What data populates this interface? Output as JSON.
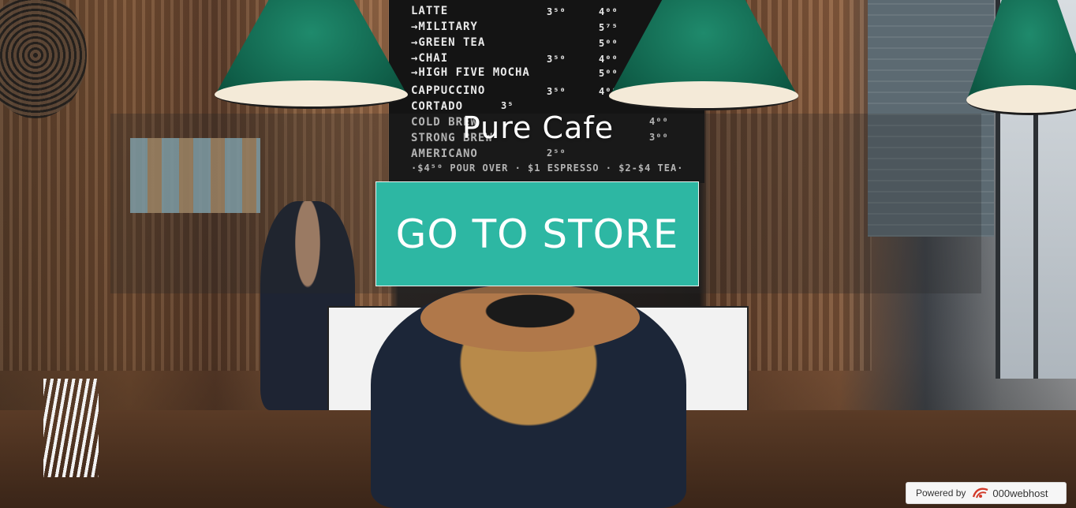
{
  "site": {
    "title": "Pure Cafe",
    "cta_label": "GO TO STORE"
  },
  "menu_board": {
    "rows": [
      {
        "item": "LATTE",
        "p1": "3⁵⁰",
        "p2": "4⁰⁰"
      },
      {
        "item": "→MILITARY",
        "p1": "",
        "p2": "5⁷⁵"
      },
      {
        "item": "→GREEN TEA",
        "p1": "",
        "p2": "5⁰⁰"
      },
      {
        "item": "→CHAI",
        "p1": "3⁵⁰",
        "p2": "4⁰⁰"
      },
      {
        "item": "→HIGH FIVE MOCHA",
        "p1": "",
        "p2": "5⁰⁰"
      },
      {
        "item": "CAPPUCCINO",
        "p1": "3⁵⁰",
        "p2": "4⁰⁰"
      },
      {
        "item": "CORTADO",
        "p1": "3⁵",
        "p2": ""
      },
      {
        "item": "COLD BREW",
        "p1": "",
        "p2": "4⁰⁰"
      },
      {
        "item": "STRONG BREW",
        "p1": "",
        "p2": "3⁰⁰"
      },
      {
        "item": "AMERICANO",
        "p1": "2⁵⁰",
        "p2": ""
      }
    ],
    "footer": "·$4⁵⁰ POUR OVER · $1 ESPRESSO · $2-$4 TEA·"
  },
  "host_badge": {
    "powered_label": "Powered by",
    "brand": "000webhost"
  },
  "colors": {
    "cta_background": "#2db7a3",
    "title_text": "#ffffff",
    "lamp_green": "#0f5e48"
  }
}
